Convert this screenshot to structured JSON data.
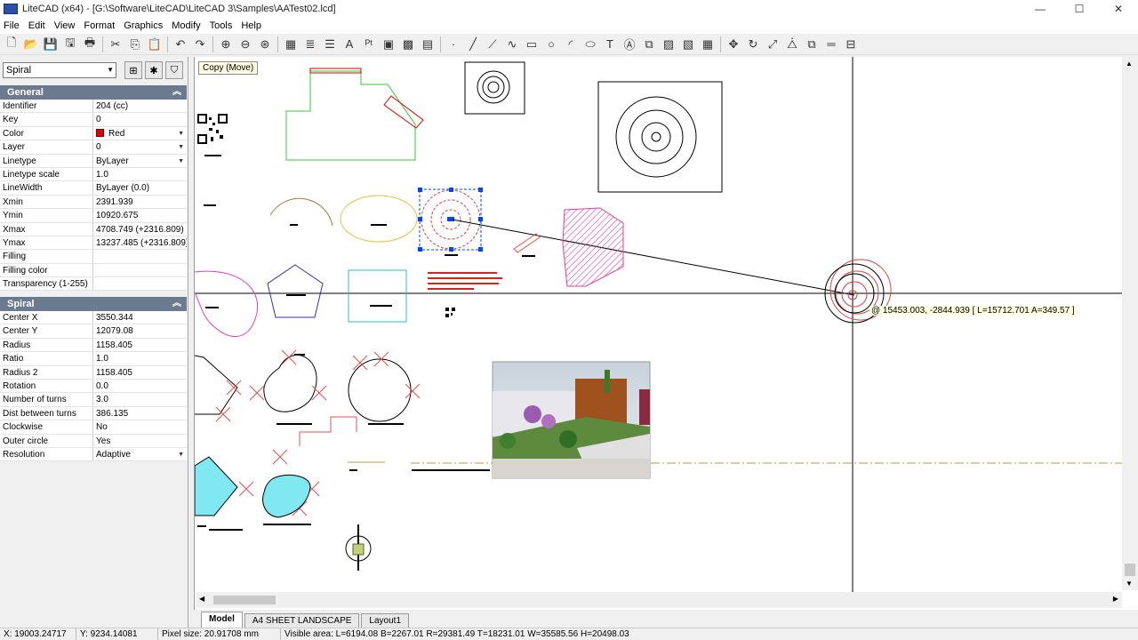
{
  "window": {
    "title": "LiteCAD (x64) - [G:\\Software\\LiteCAD\\LiteCAD 3\\Samples\\AATest02.lcd]",
    "controls": [
      "—",
      "☐",
      "✕"
    ]
  },
  "menu": [
    "File",
    "Edit",
    "View",
    "Format",
    "Graphics",
    "Modify",
    "Tools",
    "Help"
  ],
  "toolbar": {
    "icons": [
      "new-file-icon",
      "open-file-icon",
      "save-as-icon",
      "save-icon",
      "print-icon",
      "cut-icon",
      "copy-icon",
      "paste-icon",
      "undo-icon",
      "redo-icon",
      "zoom-in-icon",
      "zoom-out-icon",
      "zoom-extents-icon",
      "layers-icon",
      "line-types-icon",
      "line-weights-icon",
      "text-styles-icon",
      "point-styles-icon",
      "blocks-icon",
      "images-icon",
      "layouts-icon",
      "point-icon",
      "line-icon",
      "polyline-icon",
      "spline-icon",
      "rectangle-icon",
      "circle-icon",
      "arc-icon",
      "ellipse-icon",
      "text-icon",
      "attribute-icon",
      "insert-block-icon",
      "hatch-icon",
      "image-icon",
      "qrcode-icon",
      "move-icon",
      "rotate-icon",
      "scale-icon",
      "mirror-icon",
      "copy-objects-icon",
      "measure-icon",
      "dimension-icon"
    ],
    "glyphs": [
      "🗋",
      "📂",
      "💾",
      "🖫",
      "🖶",
      "✂",
      "⎘",
      "📋",
      "↶",
      "↷",
      "⊕",
      "⊖",
      "⊛",
      "▦",
      "≣",
      "☰",
      "A",
      "ᴾᵗ",
      "▣",
      "▩",
      "▤",
      "·",
      "╱",
      "⟋",
      "∿",
      "▭",
      "○",
      "◜",
      "⬭",
      "T",
      "Ⓐ",
      "⧉",
      "▨",
      "▧",
      "▦",
      "✥",
      "↻",
      "⤢",
      "⧊",
      "⧉",
      "═",
      "⊟"
    ]
  },
  "left_panel": {
    "object_type": "Spiral",
    "general": {
      "header": "General",
      "rows": [
        {
          "name": "Identifier",
          "value": "204 (cc)"
        },
        {
          "name": "Key",
          "value": "0"
        },
        {
          "name": "Color",
          "value": "Red",
          "swatch": "#e00000",
          "dropdown": true
        },
        {
          "name": "Layer",
          "value": "0",
          "dropdown": true
        },
        {
          "name": "Linetype",
          "value": "ByLayer",
          "dropdown": true
        },
        {
          "name": "Linetype scale",
          "value": "1.0"
        },
        {
          "name": "LineWidth",
          "value": "ByLayer (0.0)"
        },
        {
          "name": "Xmin",
          "value": "2391.939"
        },
        {
          "name": "Ymin",
          "value": "10920.675"
        },
        {
          "name": "Xmax",
          "value": "4708.749  (+2316.809)"
        },
        {
          "name": "Ymax",
          "value": "13237.485  (+2316.809)"
        },
        {
          "name": "Filling",
          "value": ""
        },
        {
          "name": "Filling color",
          "value": ""
        },
        {
          "name": "Transparency (1-255)",
          "value": ""
        }
      ]
    },
    "spiral": {
      "header": "Spiral",
      "rows": [
        {
          "name": "Center X",
          "value": "3550.344"
        },
        {
          "name": "Center Y",
          "value": "12079.08"
        },
        {
          "name": "Radius",
          "value": "1158.405"
        },
        {
          "name": "Ratio",
          "value": "1.0"
        },
        {
          "name": "Radius 2",
          "value": "1158.405"
        },
        {
          "name": "Rotation",
          "value": "0.0"
        },
        {
          "name": "Number of turns",
          "value": "3.0"
        },
        {
          "name": "Dist between turns",
          "value": "386.135"
        },
        {
          "name": "Clockwise",
          "value": "No"
        },
        {
          "name": "Outer circle",
          "value": "Yes"
        },
        {
          "name": "Resolution",
          "value": "Adaptive",
          "dropdown": true
        }
      ]
    }
  },
  "canvas": {
    "tooltip": "Copy (Move)",
    "coord_readout": "@ 15453.003, -2844.939 [ L=15712.701  A=349.57 ]"
  },
  "tabs": [
    {
      "label": "Model",
      "active": true
    },
    {
      "label": "A4 SHEET LANDSCAPE",
      "active": false
    },
    {
      "label": "Layout1",
      "active": false
    }
  ],
  "status": {
    "x": "X: 19003.24717",
    "y": "Y: 9234.14081",
    "pixel_size": "Pixel size: 20.91708 mm",
    "visible_area": "Visible area:  L=6194.08  B=2267.01  R=29381.49  T=18231.01  W=35585.56  H=20498.03"
  },
  "colors": {
    "accent_header": "#6b7a8f",
    "selection": "#0044ff",
    "spiral": "#e00000",
    "hatch": "#e0409a",
    "polyline_green": "#33cc33",
    "polygon_blue": "#3030c0",
    "rect_cyan": "#30c0c0"
  }
}
